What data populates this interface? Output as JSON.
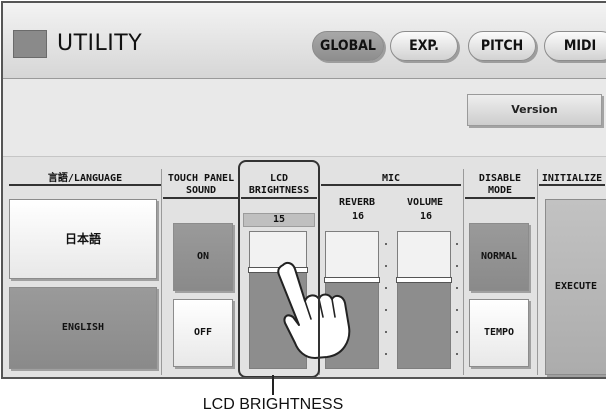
{
  "header": {
    "title": "UTILITY",
    "tabs": [
      {
        "label": "GLOBAL",
        "active": true
      },
      {
        "label": "EXP.",
        "active": false
      },
      {
        "label": "PITCH",
        "active": false
      },
      {
        "label": "MIDI",
        "active": false
      }
    ]
  },
  "version_button": "Version",
  "sections": {
    "language": {
      "title": "言語/LANGUAGE",
      "buttons": [
        {
          "label": "日本語",
          "selected": false
        },
        {
          "label": "ENGLISH",
          "selected": true
        }
      ]
    },
    "touch_panel_sound": {
      "title": "TOUCH PANEL SOUND",
      "buttons": [
        {
          "label": "ON",
          "selected": true
        },
        {
          "label": "OFF",
          "selected": false
        }
      ]
    },
    "lcd_brightness": {
      "title": "LCD BRIGHTNESS",
      "value": "15",
      "level_fraction": 0.72
    },
    "mic": {
      "title": "MIC",
      "reverb_label": "REVERB",
      "reverb_value": "16",
      "reverb_level_fraction": 0.65,
      "volume_label": "VOLUME",
      "volume_value": "16",
      "volume_level_fraction": 0.65
    },
    "disable_mode": {
      "title": "DISABLE MODE",
      "buttons": [
        {
          "label": "NORMAL",
          "selected": true
        },
        {
          "label": "TEMPO",
          "selected": false
        }
      ]
    },
    "initialize": {
      "title": "INITIALIZE",
      "button": "EXECUTE"
    }
  },
  "caption": "LCD BRIGHTNESS",
  "colors": {
    "selected": "#8e8e8e",
    "unselected": "#ffffff",
    "panel": "#e2e2e2"
  }
}
